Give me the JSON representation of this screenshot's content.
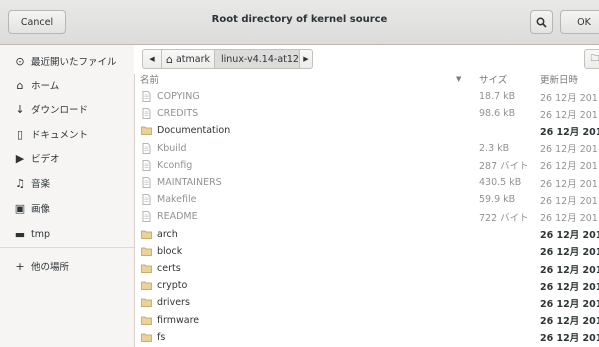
{
  "header": {
    "cancel_label": "Cancel",
    "title": "Root directory of kernel source",
    "ok_label": "OK"
  },
  "sidebar": {
    "items": [
      {
        "label": "最近開いたファイル",
        "icon": "recent-icon",
        "glyph": "⊙"
      },
      {
        "label": "ホーム",
        "icon": "home-icon",
        "glyph": "⌂"
      },
      {
        "label": "ダウンロード",
        "icon": "download-icon",
        "glyph": "↓"
      },
      {
        "label": "ドキュメント",
        "icon": "document-icon",
        "glyph": "▯"
      },
      {
        "label": "ビデオ",
        "icon": "video-icon",
        "glyph": "▶"
      },
      {
        "label": "音楽",
        "icon": "music-icon",
        "glyph": "♫"
      },
      {
        "label": "画像",
        "icon": "picture-icon",
        "glyph": "▣"
      },
      {
        "label": "tmp",
        "icon": "folder-icon",
        "glyph": "▬"
      },
      {
        "label": "他の場所",
        "icon": "plus-icon",
        "glyph": "+"
      }
    ]
  },
  "pathbar": {
    "home_label": "atmark",
    "current_label": "linux-v4.14-at12"
  },
  "columns": {
    "name": "名前",
    "size": "サイズ",
    "modified": "更新日時"
  },
  "files": [
    {
      "name": "COPYING",
      "size": "18.7 kB",
      "modified": "26 12月 201",
      "type": "file"
    },
    {
      "name": "CREDITS",
      "size": "98.6 kB",
      "modified": "26 12月 201",
      "type": "file"
    },
    {
      "name": "Documentation",
      "size": "",
      "modified": "26 12月 201",
      "type": "folder"
    },
    {
      "name": "Kbuild",
      "size": "2.3 kB",
      "modified": "26 12月 201",
      "type": "file"
    },
    {
      "name": "Kconfig",
      "size": "287 バイト",
      "modified": "26 12月 201",
      "type": "file"
    },
    {
      "name": "MAINTAINERS",
      "size": "430.5 kB",
      "modified": "26 12月 201",
      "type": "file"
    },
    {
      "name": "Makefile",
      "size": "59.9 kB",
      "modified": "26 12月 201",
      "type": "file"
    },
    {
      "name": "README",
      "size": "722 バイト",
      "modified": "26 12月 201",
      "type": "file"
    },
    {
      "name": "arch",
      "size": "",
      "modified": "26 12月 201",
      "type": "folder"
    },
    {
      "name": "block",
      "size": "",
      "modified": "26 12月 201",
      "type": "folder"
    },
    {
      "name": "certs",
      "size": "",
      "modified": "26 12月 201",
      "type": "folder"
    },
    {
      "name": "crypto",
      "size": "",
      "modified": "26 12月 201",
      "type": "folder"
    },
    {
      "name": "drivers",
      "size": "",
      "modified": "26 12月 201",
      "type": "folder"
    },
    {
      "name": "firmware",
      "size": "",
      "modified": "26 12月 201",
      "type": "folder"
    },
    {
      "name": "fs",
      "size": "",
      "modified": "26 12月 201",
      "type": "folder"
    }
  ],
  "colors": {
    "folder": "#e9d39a",
    "folder_edge": "#b89a52",
    "dim_text": "#909391"
  }
}
